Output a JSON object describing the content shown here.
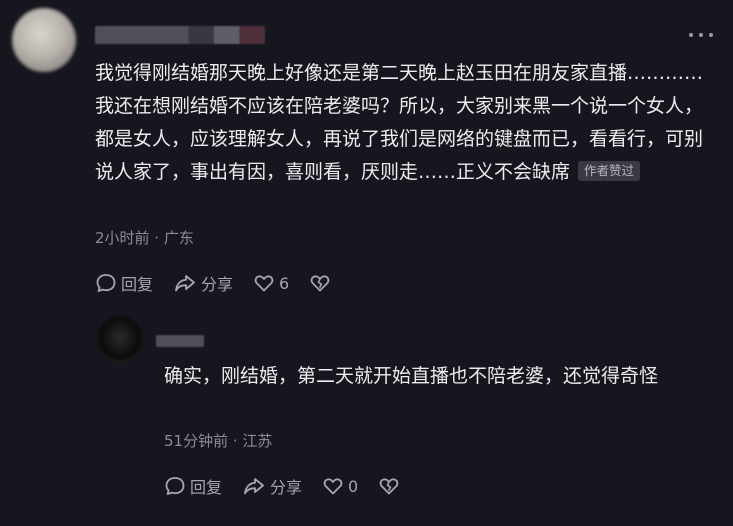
{
  "comment": {
    "text": "我觉得刚结婚那天晚上好像还是第二天晚上赵玉田在朋友家直播…………我还在想刚结婚不应该在陪老婆吗？所以，大家别来黑一个说一个女人，都是女人，应该理解女人，再说了我们是网络的键盘而已，看看行，可别说人家了，事出有因，喜则看，厌则走……正义不会缺席",
    "badge": "作者赞过",
    "meta": "2小时前 · 广东",
    "reply_label": "回复",
    "share_label": "分享",
    "like_count": "6"
  },
  "reply": {
    "text": "确实，刚结婚，第二天就开始直播也不陪老婆，还觉得奇怪",
    "meta": "51分钟前 · 江苏",
    "reply_label": "回复",
    "share_label": "分享",
    "like_count": "0"
  }
}
